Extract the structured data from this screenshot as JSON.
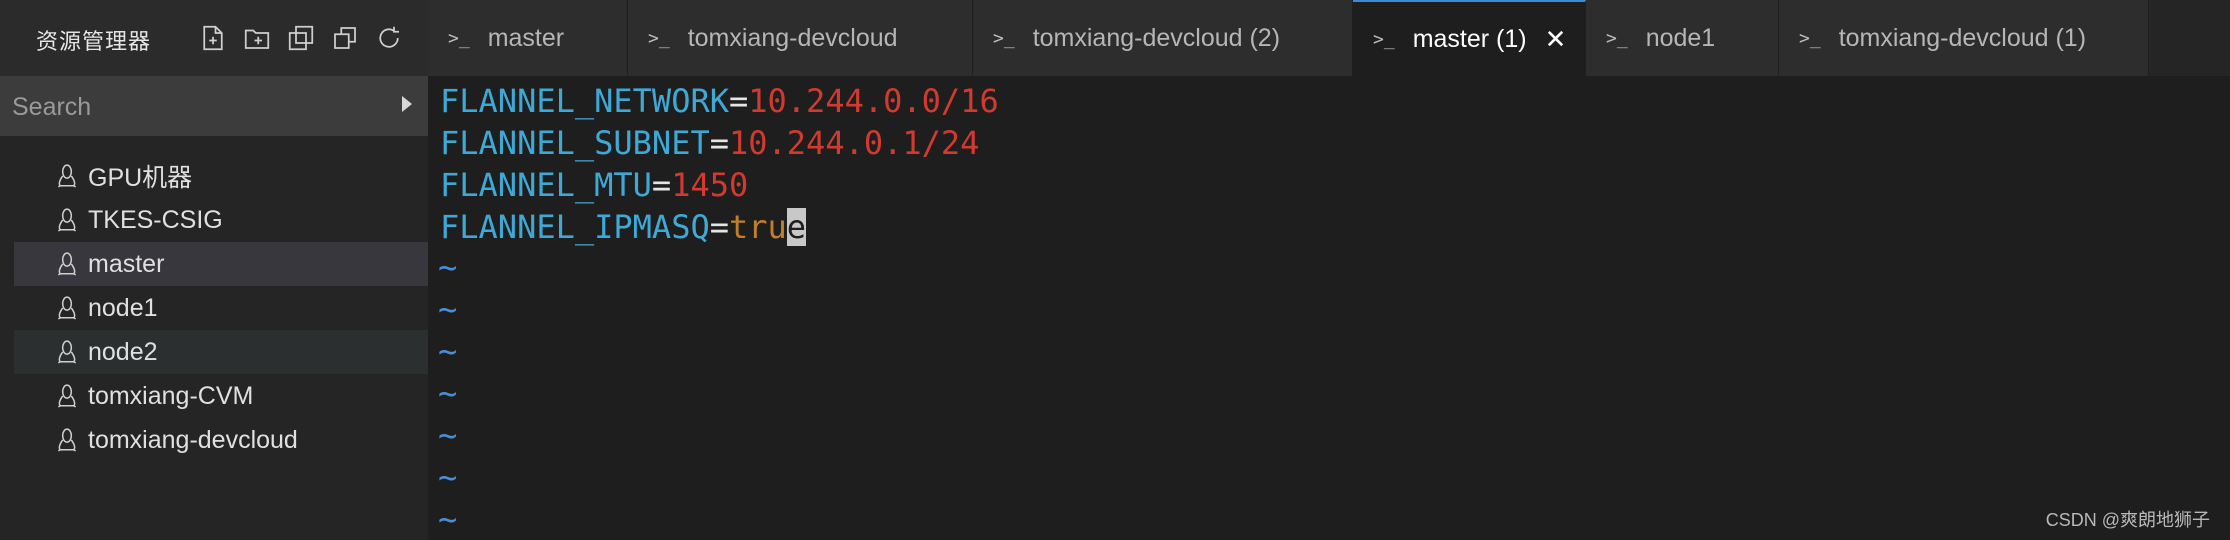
{
  "explorer": {
    "title": "资源管理器",
    "actions": [
      "new-file-icon",
      "new-folder-icon",
      "copy-icon",
      "restore-window-icon",
      "refresh-icon"
    ]
  },
  "tabs": [
    {
      "label": "master",
      "active": false
    },
    {
      "label": "tomxiang-devcloud",
      "active": false
    },
    {
      "label": "tomxiang-devcloud (2)",
      "active": false
    },
    {
      "label": "master (1)",
      "active": true
    },
    {
      "label": "node1",
      "active": false
    },
    {
      "label": "tomxiang-devcloud (1)",
      "active": false
    }
  ],
  "search": {
    "placeholder": "Search",
    "value": ""
  },
  "hosts": [
    {
      "label": "GPU机器"
    },
    {
      "label": "TKES-CSIG"
    },
    {
      "label": "master",
      "selected": true
    },
    {
      "label": "node1"
    },
    {
      "label": "node2"
    },
    {
      "label": "tomxiang-CVM"
    },
    {
      "label": "tomxiang-devcloud"
    }
  ],
  "editor": {
    "lines": [
      {
        "key": "FLANNEL_NETWORK",
        "value": "10.244.0.0/16"
      },
      {
        "key": "FLANNEL_SUBNET",
        "value": "10.244.0.1/24"
      },
      {
        "key": "FLANNEL_MTU",
        "value": "1450"
      },
      {
        "key": "FLANNEL_IPMASQ",
        "value": "true"
      }
    ],
    "tilde": "~",
    "tilde_count": 7
  },
  "colors": {
    "key": "#3fa9d6",
    "number": "#d33a2f",
    "bool": "#c0802a",
    "tilde": "#4b8ed8",
    "active_tab_border": "#3a8bd8"
  },
  "watermark": "CSDN @爽朗地狮子"
}
